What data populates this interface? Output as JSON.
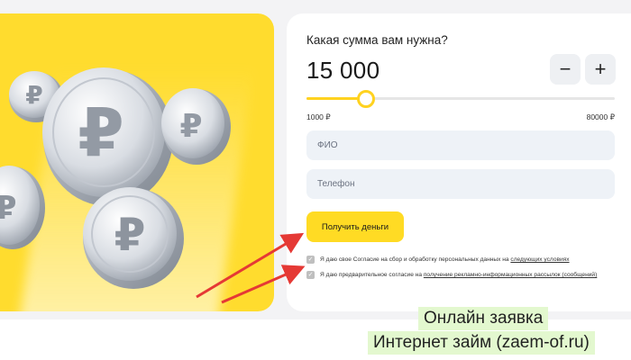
{
  "form": {
    "question": "Какая сумма вам нужна?",
    "amount": "15 000",
    "minus_label": "−",
    "plus_label": "+",
    "range_min": "1000 ₽",
    "range_max": "80000 ₽",
    "slider_fraction": 0.19,
    "fio_placeholder": "ФИО",
    "phone_placeholder": "Телефон",
    "submit_label": "Получить деньги",
    "consent1_prefix": "Я даю свое Согласие на сбор и обработку персональных данных на ",
    "consent1_link": "следующих условиях",
    "consent2_prefix": "Я даю предварительное согласие на ",
    "consent2_link": "получение рекламно-информационных рассылок (сообщений)"
  },
  "watermark": {
    "line1": "Онлайн заявка",
    "line2": "Интернет займ (zaem-of.ru)"
  },
  "colors": {
    "accent": "#ffdb24",
    "promo_bg": "#ffdc2e",
    "arrow": "#e53935",
    "watermark_bg": "#e3f8cf"
  },
  "icons": [
    "ruble-coin-icon",
    "check-icon",
    "arrow-icon"
  ]
}
